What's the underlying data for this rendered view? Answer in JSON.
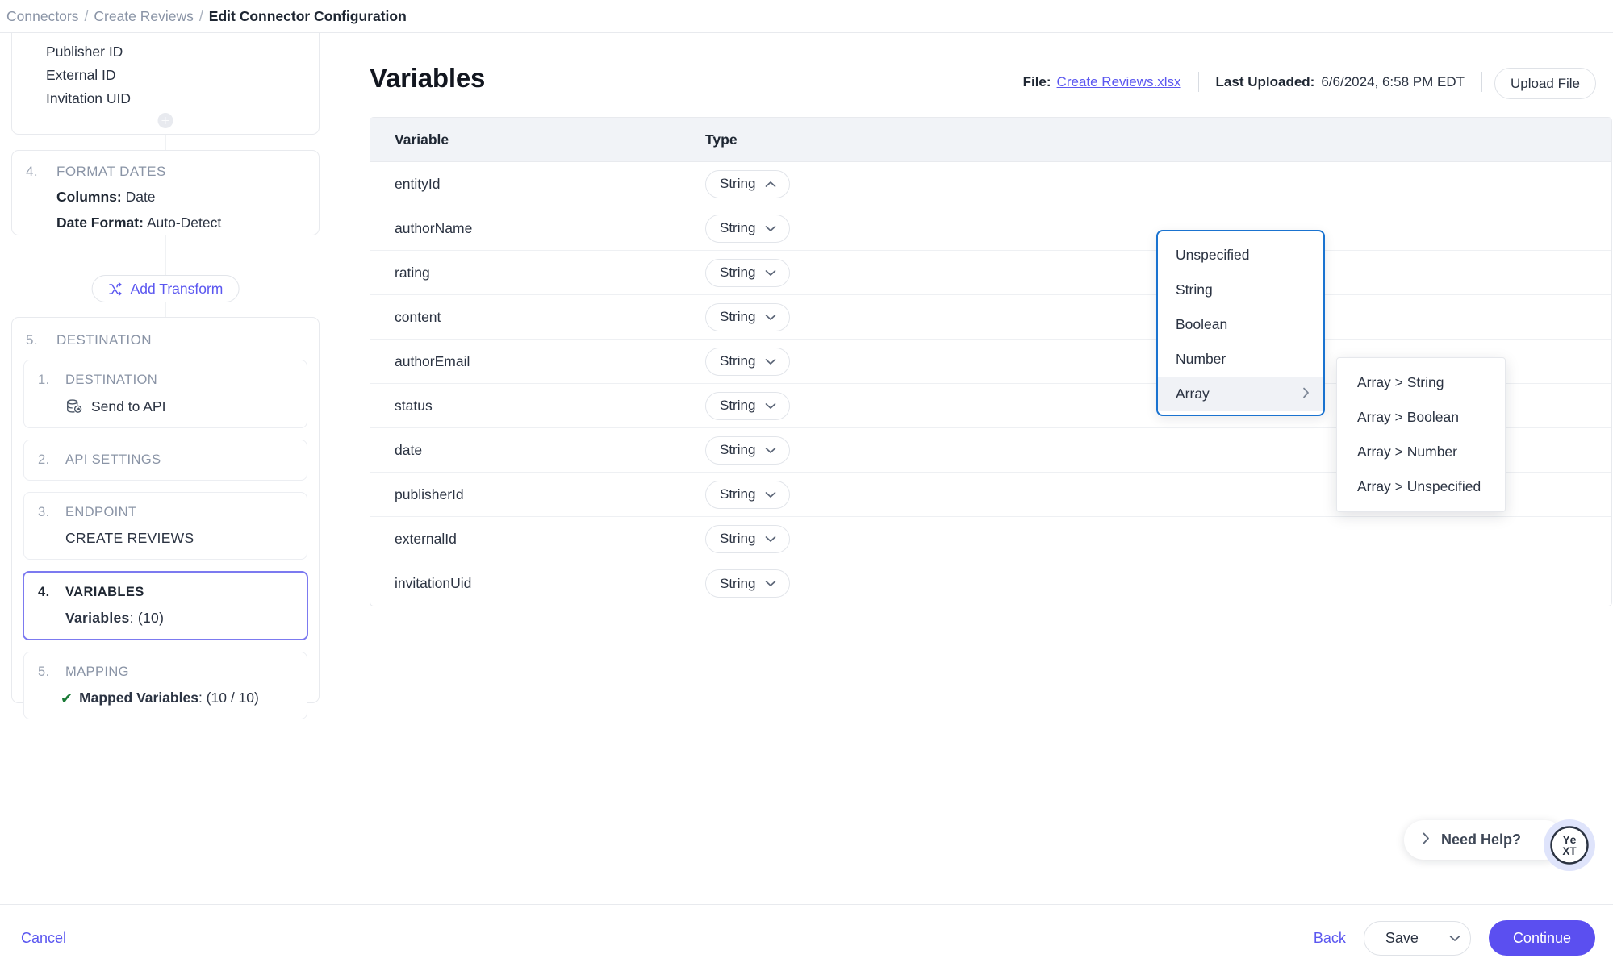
{
  "breadcrumb": {
    "items": [
      {
        "label": "Connectors",
        "current": false
      },
      {
        "label": "Create Reviews",
        "current": false
      },
      {
        "label": "Edit Connector Configuration",
        "current": true
      }
    ],
    "separator": "/"
  },
  "rail": {
    "top_card": {
      "fields": [
        "Publisher ID",
        "External ID",
        "Invitation UID"
      ],
      "add_icon": "plus-icon"
    },
    "format_dates": {
      "number": "4.",
      "title": "FORMAT DATES",
      "columns_label": "Columns:",
      "columns_value": "Date",
      "date_format_label": "Date Format:",
      "date_format_value": "Auto-Detect"
    },
    "add_transform": {
      "label": "Add Transform",
      "icon": "shuffle-icon"
    },
    "destination": {
      "number": "5.",
      "title": "DESTINATION",
      "steps": [
        {
          "number": "1.",
          "title": "DESTINATION",
          "body": "Send to API",
          "icon": "database-arrow-icon",
          "selected": false
        },
        {
          "number": "2.",
          "title": "API SETTINGS",
          "body": "",
          "selected": false
        },
        {
          "number": "3.",
          "title": "ENDPOINT",
          "body": "CREATE REVIEWS",
          "selected": false
        },
        {
          "number": "4.",
          "title": "VARIABLES",
          "body_label": "Variables",
          "body_value": ": (10)",
          "selected": true
        },
        {
          "number": "5.",
          "title": "MAPPING",
          "body_label": "Mapped Variables",
          "body_value": ": (10 / 10)",
          "check": "✔",
          "selected": false
        }
      ]
    }
  },
  "main": {
    "title": "Variables",
    "file_label": "File:",
    "file_name": "Create Reviews.xlsx",
    "last_uploaded_label": "Last Uploaded:",
    "last_uploaded_value": "6/6/2024, 6:58 PM EDT",
    "upload_button": "Upload File",
    "table": {
      "columns": [
        "Variable",
        "Type"
      ],
      "rows": [
        {
          "variable": "entityId",
          "type": "String",
          "open": true
        },
        {
          "variable": "authorName",
          "type": "String",
          "open": false
        },
        {
          "variable": "rating",
          "type": "String",
          "open": false
        },
        {
          "variable": "content",
          "type": "String",
          "open": false
        },
        {
          "variable": "authorEmail",
          "type": "String",
          "open": false
        },
        {
          "variable": "status",
          "type": "String",
          "open": false
        },
        {
          "variable": "date",
          "type": "String",
          "open": false
        },
        {
          "variable": "publisherId",
          "type": "String",
          "open": false
        },
        {
          "variable": "externalId",
          "type": "String",
          "open": false
        },
        {
          "variable": "invitationUid",
          "type": "String",
          "open": false
        }
      ]
    },
    "dropdown": {
      "options": [
        {
          "label": "Unspecified",
          "has_submenu": false,
          "highlighted": false
        },
        {
          "label": "String",
          "has_submenu": false,
          "highlighted": false
        },
        {
          "label": "Boolean",
          "has_submenu": false,
          "highlighted": false
        },
        {
          "label": "Number",
          "has_submenu": false,
          "highlighted": false
        },
        {
          "label": "Array",
          "has_submenu": true,
          "highlighted": true
        }
      ],
      "submenu": [
        "Array > String",
        "Array > Boolean",
        "Array > Number",
        "Array > Unspecified"
      ]
    }
  },
  "help": {
    "label": "Need Help?",
    "chevron": "❯",
    "badge_icon": "yext-logo-icon"
  },
  "footer": {
    "cancel": "Cancel",
    "back": "Back",
    "save": "Save",
    "continue": "Continue"
  },
  "colors": {
    "accent_purple": "#5b4ff0",
    "link_purple": "#5b57f0",
    "dropdown_border_blue": "#1a73d0",
    "check_green": "#1a7a36",
    "header_gray": "#f1f3f7"
  }
}
